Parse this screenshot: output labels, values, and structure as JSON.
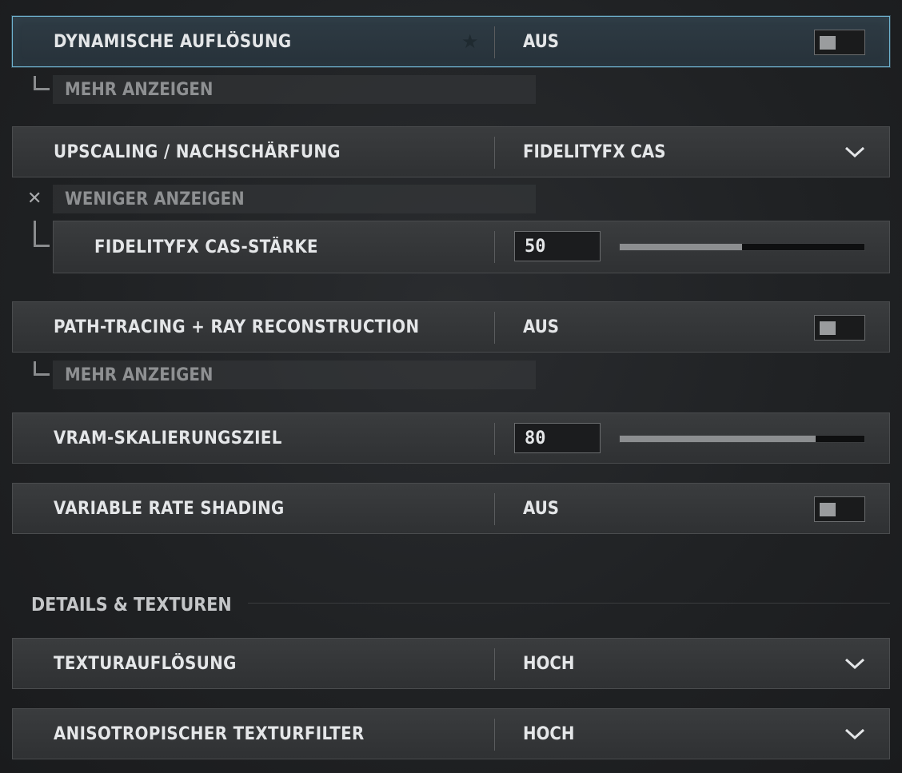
{
  "rows": {
    "dynamic_resolution": {
      "label": "DYNAMISCHE AUFLÖSUNG",
      "value": "AUS",
      "favorite_icon": "star-icon",
      "toggle_on": false
    },
    "upscaling": {
      "label": "UPSCALING / NACHSCHÄRFUNG",
      "value": "FIDELITYFX CAS"
    },
    "cas_strength": {
      "label": "FIDELITYFX CAS-STÄRKE",
      "value": "50",
      "slider_value": 50,
      "slider_max": 100
    },
    "path_tracing": {
      "label": "PATH-TRACING + RAY RECONSTRUCTION",
      "value": "AUS",
      "toggle_on": false
    },
    "vram_target": {
      "label": "VRAM-SKALIERUNGSZIEL",
      "value": "80",
      "slider_value": 80,
      "slider_max": 100
    },
    "vrs": {
      "label": "VARIABLE RATE SHADING",
      "value": "AUS",
      "toggle_on": false
    },
    "texture_resolution": {
      "label": "TEXTURAUFLÖSUNG",
      "value": "HOCH"
    },
    "aniso_filter": {
      "label": "ANISOTROPISCHER TEXTURFILTER",
      "value": "HOCH"
    }
  },
  "expanders": {
    "more_1": "MEHR ANZEIGEN",
    "less_1": "WENIGER ANZEIGEN",
    "more_2": "MEHR ANZEIGEN"
  },
  "sections": {
    "details_textures": "DETAILS & TEXTUREN"
  },
  "colors": {
    "accent_focus": "#6fb3d0",
    "slider_fill": "#8c8e90"
  }
}
